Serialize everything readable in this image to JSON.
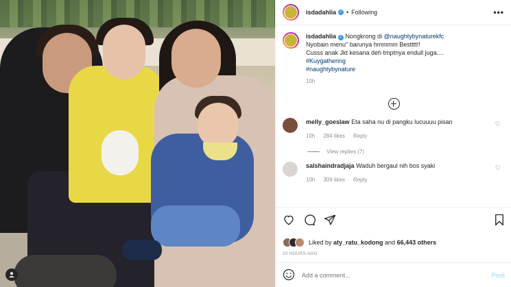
{
  "post": {
    "username": "isdadahlia",
    "following_label": "Following",
    "more_label": "•••",
    "caption_prefix": "Nongkrong di ",
    "caption_mention": "@naughtybynaturekfc",
    "caption_line2": "Nyobain menu\" barunya hmmmm Bestttt!!",
    "caption_line3": "Cusss anak Jkt kesana deh tmptnya endull juga....",
    "hashtag1": "#Kuygathering",
    "hashtag2": "#naughtybynature",
    "caption_time": "10h"
  },
  "comments": [
    {
      "username": "melly_goeslaw",
      "text": "Eta saha nu di pangku lucuuuu pisan",
      "time": "10h",
      "likes": "284 likes",
      "reply": "Reply",
      "avatar_color": "#7a4e3c"
    },
    {
      "username": "salshaindradjaja",
      "text": "Waduh bergaul nih bos syaki",
      "time": "10h",
      "likes": "309 likes",
      "reply": "Reply",
      "avatar_color": "#d9d6d2"
    }
  ],
  "view_replies": "View replies (7)",
  "likes": {
    "prefix": "Liked by ",
    "user": "aty_ratu_kodong",
    "middle": " and ",
    "count": "66,443 others",
    "avatar_colors": [
      "#8a6b55",
      "#2b2b2b",
      "#b88a6e"
    ]
  },
  "time_ago": "10 HOURS AGO",
  "add_comment": {
    "placeholder": "Add a comment...",
    "post_label": "Post"
  },
  "colors": {
    "link": "#00376b",
    "verified": "#3897f0",
    "muted": "#8e8e8e",
    "post_button": "#b2dffc"
  }
}
